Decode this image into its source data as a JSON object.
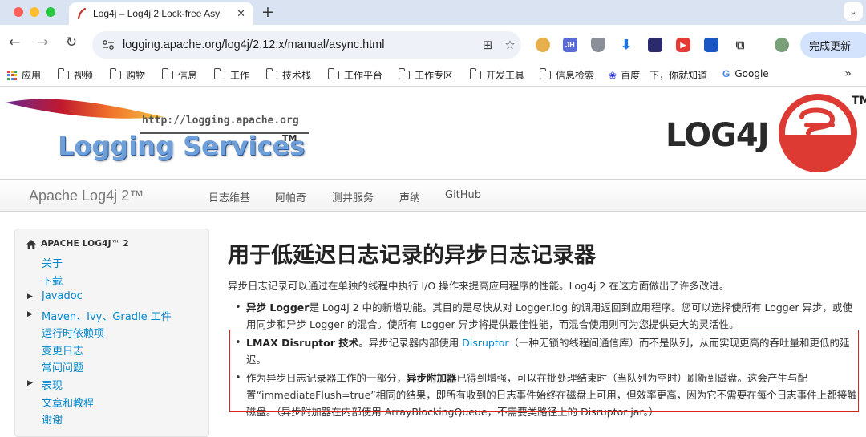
{
  "browser": {
    "tab_title": "Log4j – Log4j 2 Lock-free Asy",
    "new_tab": "+",
    "url_host": "logging.apache.org",
    "url_path": "/log4j/2.12.x/manual/async.html",
    "extensions": [
      {
        "name": "jh-extension-icon",
        "label": "JH",
        "color": "#5b6bd6"
      },
      {
        "name": "shield-extension-icon",
        "label": "",
        "color": "#8a8f99"
      }
    ],
    "update_button": "完成更新",
    "bookmarks": [
      {
        "label": "应用",
        "type": "apps"
      },
      {
        "label": "视频",
        "type": "folder"
      },
      {
        "label": "购物",
        "type": "folder"
      },
      {
        "label": "信息",
        "type": "folder"
      },
      {
        "label": "工作",
        "type": "folder"
      },
      {
        "label": "技术栈",
        "type": "folder"
      },
      {
        "label": "工作平台",
        "type": "folder"
      },
      {
        "label": "工作专区",
        "type": "folder"
      },
      {
        "label": "开发工具",
        "type": "folder"
      },
      {
        "label": "信息检索",
        "type": "folder"
      },
      {
        "label": "百度一下，你就知道",
        "type": "baidu"
      },
      {
        "label": "Google",
        "type": "google"
      }
    ],
    "bookmarks_more": "»"
  },
  "banner": {
    "logging_url": "http://logging.apache.org",
    "logging_name": "Logging Services",
    "logging_tm": "TM",
    "log4j_word": "LOG4J",
    "log4j_tm": "TM"
  },
  "navbar": {
    "brand": "Apache Log4j 2™",
    "links": [
      "日志维基",
      "阿帕奇",
      "测井服务",
      "声纳",
      "GitHub"
    ]
  },
  "sidebar": {
    "header": "APACHE LOG4J™ 2",
    "items": [
      {
        "label": "关于",
        "caret": false
      },
      {
        "label": "下载",
        "caret": false
      },
      {
        "label": "Javadoc",
        "caret": true
      },
      {
        "label": "Maven、Ivy、Gradle 工件",
        "caret": true
      },
      {
        "label": "运行时依赖项",
        "caret": false
      },
      {
        "label": "变更日志",
        "caret": false
      },
      {
        "label": "常问问题",
        "caret": false
      },
      {
        "label": "表现",
        "caret": true
      },
      {
        "label": "文章和教程",
        "caret": false
      },
      {
        "label": "谢谢",
        "caret": false
      }
    ]
  },
  "content": {
    "title": "用于低延迟日志记录的异步日志记录器",
    "intro": "异步日志记录可以通过在单独的线程中执行 I/O 操作来提高应用程序的性能。Log4j 2 在这方面做出了许多改进。",
    "bullet1_bold": "异步 Logger",
    "bullet1_text": "是 Log4j 2 中的新增功能。其目的是尽快从对 Logger.log 的调用返回到应用程序。您可以选择使所有 Logger 异步，或使用同步和异步 Logger 的混合。使所有 Logger 异步将提供最佳性能，而混合使用则可为您提供更大的灵活性。",
    "bullet2_bold": "LMAX Disruptor 技术",
    "bullet2_pre": "。异步记录器内部使用 ",
    "bullet2_link": "Disruptor",
    "bullet2_post": "（一种无锁的线程间通信库）而不是队列，从而实现更高的吞吐量和更低的延迟。",
    "bullet3_pre": "作为异步日志记录器工作的一部分，",
    "bullet3_bold": "异步附加器",
    "bullet3_post": "已得到增强，可以在批处理结束时（当队列为空时）刷新到磁盘。这会产生与配置“immediateFlush=true”相同的结果，即所有收到的日志事件始终在磁盘上可用，但效率更高，因为它不需要在每个日志事件上都接触磁盘。（异步附加器在内部使用 ArrayBlockingQueue，不需要类路径上的 Disruptor jar。）"
  }
}
